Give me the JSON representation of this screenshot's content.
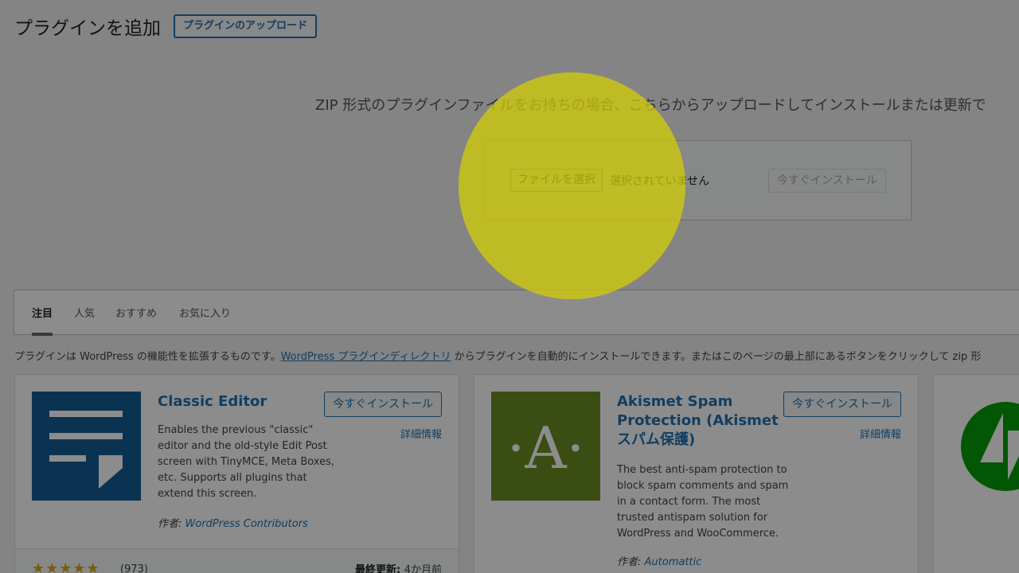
{
  "header": {
    "title": "プラグインを追加",
    "upload_button": "プラグインのアップロード"
  },
  "upload": {
    "description": "ZIP 形式のプラグインファイルをお持ちの場合、こちらからアップロードしてインストールまたは更新で",
    "choose_file": "ファイルを選択",
    "no_file": "選択されていません",
    "install_now": "今すぐインストール"
  },
  "tabs": [
    {
      "label": "注目",
      "current": true
    },
    {
      "label": "人気",
      "current": false
    },
    {
      "label": "おすすめ",
      "current": false
    },
    {
      "label": "お気に入り",
      "current": false
    }
  ],
  "intro": {
    "before": "プラグインは WordPress の機能性を拡張するものです。",
    "link": "WordPress プラグインディレクトリ",
    "after": " からプラグインを自動的にインストールできます。またはこのページの最上部にあるボタンをクリックして zip 形"
  },
  "cards": [
    {
      "name": "Classic Editor",
      "install": "今すぐインストール",
      "details": "詳細情報",
      "description": "Enables the previous \"classic\" editor and the old-style Edit Post screen with TinyMCE, Meta Boxes, etc. Supports all plugins that extend this screen.",
      "author_label": "作者: ",
      "author": "WordPress Contributors",
      "stars": "★★★★★",
      "rating_count": "(973)",
      "updated_label": "最終更新: ",
      "updated": "4か月前"
    },
    {
      "name": "Akismet Spam Protection (Akismet スパム保護)",
      "install": "今すぐインストール",
      "details": "詳細情報",
      "description": "The best anti-spam protection to block spam comments and spam in a contact form. The most trusted antispam solution for WordPress and WooCommerce.",
      "author_label": "作者: ",
      "author": "Automattic",
      "icon_letter": "·A·"
    }
  ],
  "colors": {
    "accent": "#2271b1",
    "classic_editor_icon": "#135e96",
    "akismet_icon": "#6b8e23",
    "jetpack_icon": "#069e08",
    "highlight": "#d6d000"
  }
}
